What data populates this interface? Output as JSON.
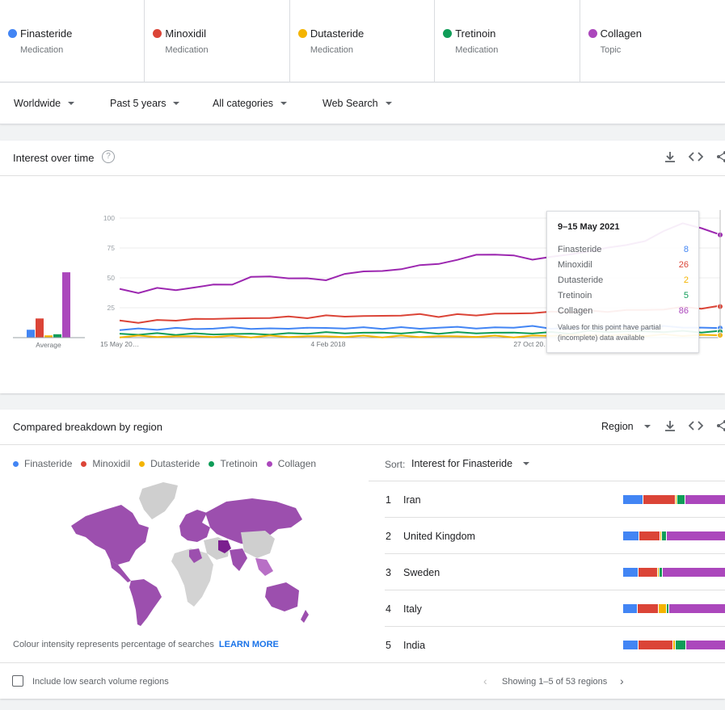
{
  "terms": [
    {
      "name": "Finasteride",
      "kind": "Medication",
      "color": "#4285f4"
    },
    {
      "name": "Minoxidil",
      "kind": "Medication",
      "color": "#db4437"
    },
    {
      "name": "Dutasteride",
      "kind": "Medication",
      "color": "#f4b400"
    },
    {
      "name": "Tretinoin",
      "kind": "Medication",
      "color": "#0f9d58"
    },
    {
      "name": "Collagen",
      "kind": "Topic",
      "color": "#ab47bc"
    }
  ],
  "filters": {
    "region": "Worldwide",
    "time": "Past 5 years",
    "category": "All categories",
    "search_type": "Web Search"
  },
  "interest": {
    "title": "Interest over time",
    "help": "?",
    "avg_label": "Average",
    "y_ticks": [
      "100",
      "75",
      "50",
      "25"
    ],
    "x_ticks": [
      "15 May 20…",
      "4 Feb 2018",
      "27 Oct 20…"
    ],
    "tooltip": {
      "date": "9–15 May 2021",
      "rows": [
        {
          "name": "Finasteride",
          "value": "8"
        },
        {
          "name": "Minoxidil",
          "value": "26"
        },
        {
          "name": "Dutasteride",
          "value": "2"
        },
        {
          "name": "Tretinoin",
          "value": "5"
        },
        {
          "name": "Collagen",
          "value": "86"
        }
      ],
      "note": "Values for this point have partial (incomplete) data available"
    }
  },
  "chart_data": {
    "type": "line",
    "ylim": [
      0,
      100
    ],
    "averages": [
      {
        "name": "Finasteride",
        "value": 7
      },
      {
        "name": "Minoxidil",
        "value": 17
      },
      {
        "name": "Dutasteride",
        "value": 2
      },
      {
        "name": "Tretinoin",
        "value": 3
      },
      {
        "name": "Collagen",
        "value": 58
      }
    ],
    "series": [
      {
        "name": "Collagen",
        "color": "#9c27b0",
        "values": [
          40,
          38,
          41,
          40,
          42,
          44,
          45,
          50,
          52,
          49,
          50,
          48,
          53,
          56,
          55,
          58,
          60,
          62,
          65,
          69,
          70,
          68,
          66,
          67,
          70,
          72,
          75,
          78,
          80,
          90,
          95,
          92,
          86
        ]
      },
      {
        "name": "Minoxidil",
        "color": "#db4437",
        "values": [
          14,
          13,
          14,
          15,
          15,
          16,
          16,
          16,
          17,
          17,
          17,
          18,
          18,
          18,
          18,
          19,
          19,
          18,
          19,
          19,
          20,
          20,
          21,
          21,
          22,
          22,
          22,
          23,
          23,
          24,
          25,
          25,
          26
        ]
      },
      {
        "name": "Finasteride",
        "color": "#4285f4",
        "values": [
          7,
          7,
          7,
          8,
          7,
          8,
          8,
          8,
          7,
          8,
          8,
          8,
          8,
          8,
          8,
          8,
          8,
          8,
          9,
          8,
          8,
          9,
          9,
          8,
          8,
          8,
          9,
          9,
          8,
          9,
          9,
          8,
          8
        ]
      },
      {
        "name": "Tretinoin",
        "color": "#0f9d58",
        "values": [
          3,
          3,
          3,
          3,
          3,
          3,
          3,
          3,
          3,
          3,
          4,
          4,
          4,
          4,
          4,
          4,
          4,
          4,
          4,
          4,
          4,
          4,
          4,
          4,
          4,
          5,
          5,
          5,
          5,
          5,
          5,
          5,
          5
        ]
      },
      {
        "name": "Dutasteride",
        "color": "#f4b400",
        "values": [
          1,
          1,
          1,
          1,
          1,
          1,
          1,
          1,
          1,
          1,
          1,
          1,
          1,
          1,
          1,
          1,
          1,
          1,
          1,
          1,
          1,
          1,
          1,
          2,
          2,
          2,
          2,
          2,
          2,
          2,
          2,
          2,
          2
        ]
      }
    ]
  },
  "region": {
    "title": "Compared breakdown by region",
    "selector": "Region",
    "sort_label": "Sort:",
    "sort_value": "Interest for Finasteride",
    "intensity_note": "Colour intensity represents percentage of searches",
    "learn_more": "LEARN MORE",
    "include_low": "Include low search volume regions",
    "pager": "Showing 1–5 of 53 regions",
    "ranks": [
      {
        "n": "1",
        "name": "Iran",
        "shares": [
          24,
          40,
          2,
          10,
          50
        ]
      },
      {
        "n": "2",
        "name": "United Kingdom",
        "shares": [
          19,
          26,
          2,
          6,
          73
        ]
      },
      {
        "n": "3",
        "name": "Sweden",
        "shares": [
          18,
          24,
          2,
          4,
          82
        ]
      },
      {
        "n": "4",
        "name": "Italy",
        "shares": [
          17,
          26,
          10,
          3,
          70
        ]
      },
      {
        "n": "5",
        "name": "India",
        "shares": [
          18,
          43,
          3,
          13,
          49
        ]
      }
    ]
  }
}
